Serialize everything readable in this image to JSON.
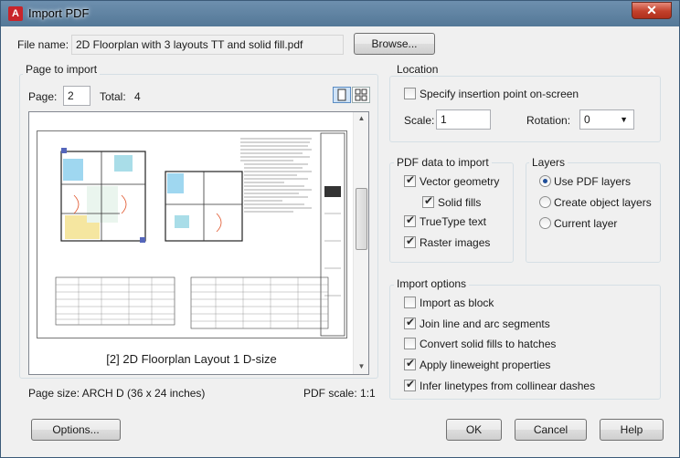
{
  "window": {
    "title": "Import PDF",
    "close_glyph": "✕",
    "app_icon": "autocad-a-icon"
  },
  "file": {
    "label": "File name:",
    "value": "2D Floorplan with 3 layouts TT and solid fill.pdf",
    "browse_label": "Browse..."
  },
  "page_to_import": {
    "title": "Page to import",
    "page_label": "Page:",
    "page_value": "2",
    "total_label": "Total:",
    "total_value": "4",
    "caption": "[2] 2D Floorplan Layout 1 D-size",
    "page_size": "Page size:  ARCH D (36 x 24 inches)",
    "pdf_scale": "PDF scale: 1:1"
  },
  "location": {
    "title": "Location",
    "specify_label": "Specify insertion point on-screen",
    "specify_checked": false,
    "scale_label": "Scale:",
    "scale_value": "1",
    "rotation_label": "Rotation:",
    "rotation_value": "0"
  },
  "pdf_data": {
    "title": "PDF data to import",
    "items": [
      {
        "label": "Vector geometry",
        "checked": true
      },
      {
        "label": "Solid fills",
        "checked": true
      },
      {
        "label": "TrueType text",
        "checked": true
      },
      {
        "label": "Raster images",
        "checked": true
      }
    ]
  },
  "layers": {
    "title": "Layers",
    "items": [
      {
        "label": "Use PDF layers",
        "selected": true
      },
      {
        "label": "Create object layers",
        "selected": false
      },
      {
        "label": "Current layer",
        "selected": false
      }
    ]
  },
  "import_options": {
    "title": "Import options",
    "items": [
      {
        "label": "Import as block",
        "checked": false
      },
      {
        "label": "Join line and arc segments",
        "checked": true
      },
      {
        "label": "Convert solid fills to hatches",
        "checked": false
      },
      {
        "label": "Apply lineweight properties",
        "checked": true
      },
      {
        "label": "Infer linetypes from collinear dashes",
        "checked": true
      }
    ]
  },
  "buttons": {
    "options": "Options...",
    "ok": "OK",
    "cancel": "Cancel",
    "help": "Help"
  }
}
